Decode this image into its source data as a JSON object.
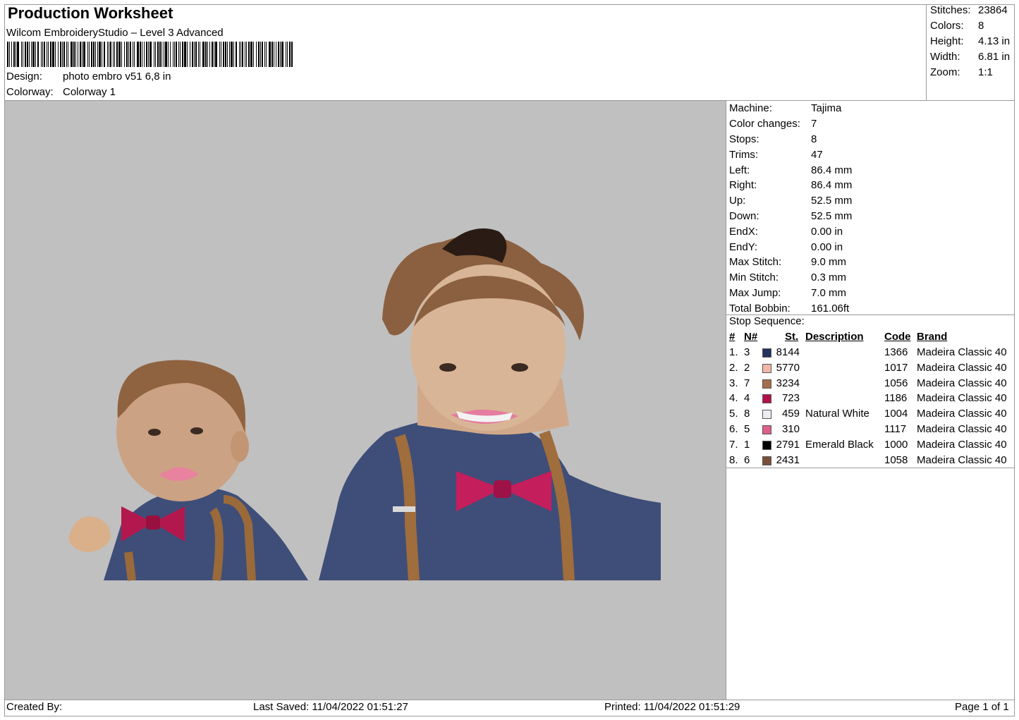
{
  "header": {
    "title": "Production Worksheet",
    "subtitle": "Wilcom EmbroideryStudio – Level 3 Advanced",
    "barcode_label": "barcode",
    "design_label": "Design:",
    "design_value": "photo embro v51 6,8 in",
    "colorway_label": "Colorway:",
    "colorway_value": "Colorway 1"
  },
  "summary": {
    "stitches_label": "Stitches:",
    "stitches_value": "23864",
    "colors_label": "Colors:",
    "colors_value": "8",
    "height_label": "Height:",
    "height_value": "4.13 in",
    "width_label": "Width:",
    "width_value": "6.81 in",
    "zoom_label": "Zoom:",
    "zoom_value": "1:1"
  },
  "specs": [
    {
      "label": "Machine:",
      "value": "Tajima"
    },
    {
      "label": "Color changes:",
      "value": "7"
    },
    {
      "label": "Stops:",
      "value": "8"
    },
    {
      "label": "Trims:",
      "value": "47"
    },
    {
      "label": "Left:",
      "value": "86.4 mm"
    },
    {
      "label": "Right:",
      "value": "86.4 mm"
    },
    {
      "label": "Up:",
      "value": "52.5 mm"
    },
    {
      "label": "Down:",
      "value": "52.5 mm"
    },
    {
      "label": "EndX:",
      "value": "0.00 in"
    },
    {
      "label": "EndY:",
      "value": "0.00 in"
    },
    {
      "label": "Max Stitch:",
      "value": "9.0 mm"
    },
    {
      "label": "Min Stitch:",
      "value": "0.3 mm"
    },
    {
      "label": "Max Jump:",
      "value": "7.0 mm"
    },
    {
      "label": "Total Bobbin:",
      "value": "161.06ft"
    }
  ],
  "stop_sequence": {
    "title": "Stop Sequence:",
    "columns": {
      "num": "#",
      "needle": "N#",
      "st": "St.",
      "description": "Description",
      "code": "Code",
      "brand": "Brand"
    },
    "rows": [
      {
        "num": "1.",
        "needle": "3",
        "color": "#25315f",
        "st": "8144",
        "description": "",
        "code": "1366",
        "brand": "Madeira Classic 40"
      },
      {
        "num": "2.",
        "needle": "2",
        "color": "#f1b8a8",
        "st": "5770",
        "description": "",
        "code": "1017",
        "brand": "Madeira Classic 40"
      },
      {
        "num": "3.",
        "needle": "7",
        "color": "#a46f4c",
        "st": "3234",
        "description": "",
        "code": "1056",
        "brand": "Madeira Classic 40"
      },
      {
        "num": "4.",
        "needle": "4",
        "color": "#b2104a",
        "st": "723",
        "description": "",
        "code": "1186",
        "brand": "Madeira Classic 40"
      },
      {
        "num": "5.",
        "needle": "8",
        "color": "#ececf2",
        "st": "459",
        "description": "Natural White",
        "code": "1004",
        "brand": "Madeira Classic 40"
      },
      {
        "num": "6.",
        "needle": "5",
        "color": "#de5f8a",
        "st": "310",
        "description": "",
        "code": "1117",
        "brand": "Madeira Classic 40"
      },
      {
        "num": "7.",
        "needle": "1",
        "color": "#000000",
        "st": "2791",
        "description": "Emerald Black",
        "code": "1000",
        "brand": "Madeira Classic 40"
      },
      {
        "num": "8.",
        "needle": "6",
        "color": "#7a4f3a",
        "st": "2431",
        "description": "",
        "code": "1058",
        "brand": "Madeira Classic 40"
      }
    ]
  },
  "footer": {
    "created_by": "Created By:",
    "last_saved": "Last Saved: 11/04/2022 01:51:27",
    "printed": "Printed: 11/04/2022 01:51:29",
    "page": "Page 1 of 1"
  },
  "canvas": {
    "background": "#c0c0c0",
    "image_name": "embroidery-design-preview"
  }
}
